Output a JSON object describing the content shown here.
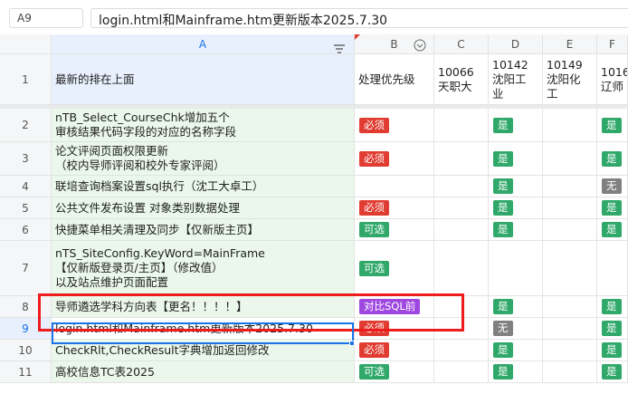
{
  "formula_bar": {
    "cell_ref": "A9",
    "content": "login.html和Mainframe.htm更新版本2025.7.30"
  },
  "columns": [
    "A",
    "B",
    "C",
    "D",
    "E",
    "F"
  ],
  "header_row": {
    "row_num": "1",
    "a": "最新的排在上面",
    "b": "处理优先级",
    "c": "10066\n天职大",
    "d": "10142\n沈阳工\n业",
    "e": "10149\n沈阳化\n工",
    "f": "1016\n辽师"
  },
  "rows": [
    {
      "num": "2",
      "a": "nTB_Select_CourseChk增加五个\n审核结果代码字段的对应的名称字段",
      "b": "必须",
      "d": "是",
      "f": "是"
    },
    {
      "num": "3",
      "a": "论文评阅页面权限更新\n（校内导师评阅和校外专家评阅）",
      "b": "必须",
      "d": "是",
      "f": "是"
    },
    {
      "num": "4",
      "a": "联培查询档案设置sql执行（沈工大卓工）",
      "b": "",
      "d": "是",
      "f": "无"
    },
    {
      "num": "5",
      "a": "公共文件发布设置 对象类别数据处理",
      "b": "必须",
      "d": "是",
      "f": "是"
    },
    {
      "num": "6",
      "a": "快捷菜单相关清理及同步【仅新版主页】",
      "b": "可选",
      "d": "是",
      "f": "是"
    },
    {
      "num": "7",
      "a": "nTS_SiteConfig.KeyWord=MainFrame\n【仅新版登录页/主页】（修改值）\n以及站点维护页面配置",
      "b": "可选",
      "d": "",
      "f": ""
    },
    {
      "num": "8",
      "a": "导师遴选学科方向表【更名！！！！】",
      "b": "对比SQL前",
      "d": "是",
      "f": "是"
    },
    {
      "num": "9",
      "a": "login.html和Mainframe.htm更新版本2025.7.30",
      "b": "必须",
      "d": "无",
      "f": "是"
    },
    {
      "num": "10",
      "a": "CheckRlt,CheckResult字典增加返回修改",
      "b": "必须",
      "d": "是",
      "f": "是"
    },
    {
      "num": "11",
      "a": "高校信息TC表2025",
      "b": "可选",
      "d": "是",
      "f": "是"
    }
  ],
  "colors": {
    "required": "#e03c31",
    "optional": "#2fa86a",
    "compare": "#9f48e0",
    "yes": "#2fa86a",
    "none": "#808080",
    "highlight": "#ee1c1c"
  }
}
